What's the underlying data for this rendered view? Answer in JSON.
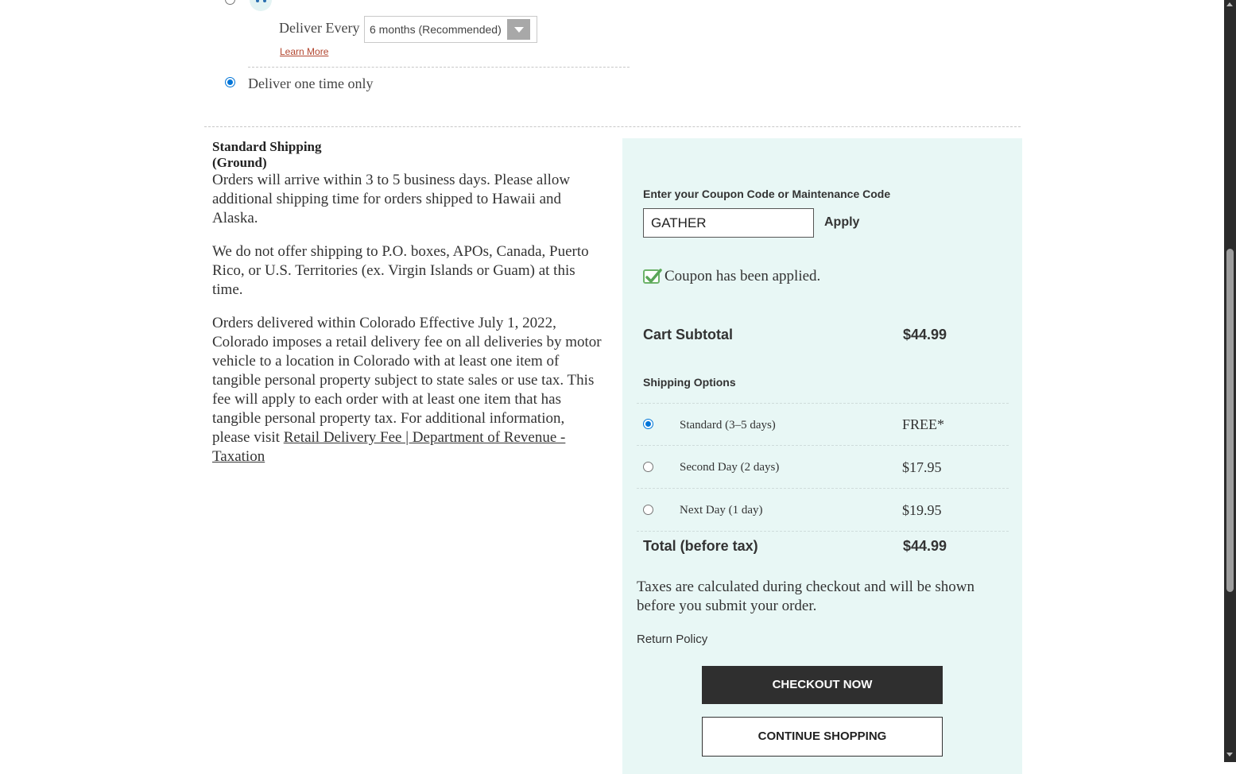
{
  "delivery": {
    "deliver_every_label": "Deliver Every",
    "frequency_selected": "6 months (Recommended)",
    "learn_more": "Learn More",
    "one_time_label": "Deliver one time only"
  },
  "shipping_info": {
    "title": "Standard Shipping (Ground)",
    "para1": "Orders will arrive within 3 to 5 business days. Please allow additional shipping time for orders shipped to Hawaii and Alaska.",
    "para2": "We do not offer shipping to P.O. boxes, APOs, Canada, Puerto Rico, or U.S. Territories (ex. Virgin Islands or Guam) at this time.",
    "para3": "Orders delivered within Colorado Effective July 1, 2022, Colorado imposes a retail delivery fee on all deliveries by motor vehicle to a location in Colorado with at least one item of tangible personal property subject to state sales or use tax. This fee will apply to each order with at least one item that has tangible personal property tax. For additional information, please visit",
    "link_text": "Retail Delivery Fee | Department of Revenue - Taxation"
  },
  "summary": {
    "coupon_label": "Enter your Coupon Code or Maintenance Code",
    "coupon_value": "GATHER",
    "apply_label": "Apply",
    "coupon_applied": "Coupon has been applied.",
    "subtotal_label": "Cart Subtotal",
    "subtotal_value": "$44.99",
    "shipping_options_label": "Shipping Options",
    "options": [
      {
        "name": "Standard (3–5 days)",
        "price": "FREE*"
      },
      {
        "name": "Second Day (2 days)",
        "price": "$17.95"
      },
      {
        "name": "Next Day (1 day)",
        "price": "$19.95"
      }
    ],
    "total_label": "Total (before tax)",
    "total_value": "$44.99",
    "tax_note": "Taxes are calculated during checkout and will be shown before you submit your order.",
    "return_policy": "Return Policy",
    "checkout_label": "CHECKOUT NOW",
    "continue_label": "CONTINUE SHOPPING"
  },
  "colors": {
    "panel_bg": "#e8f7f5",
    "radio_accent": "#0075d8",
    "checkmark": "#6db36a",
    "dark_button": "#2f2f2f",
    "learn_more_link": "#b2462f"
  }
}
